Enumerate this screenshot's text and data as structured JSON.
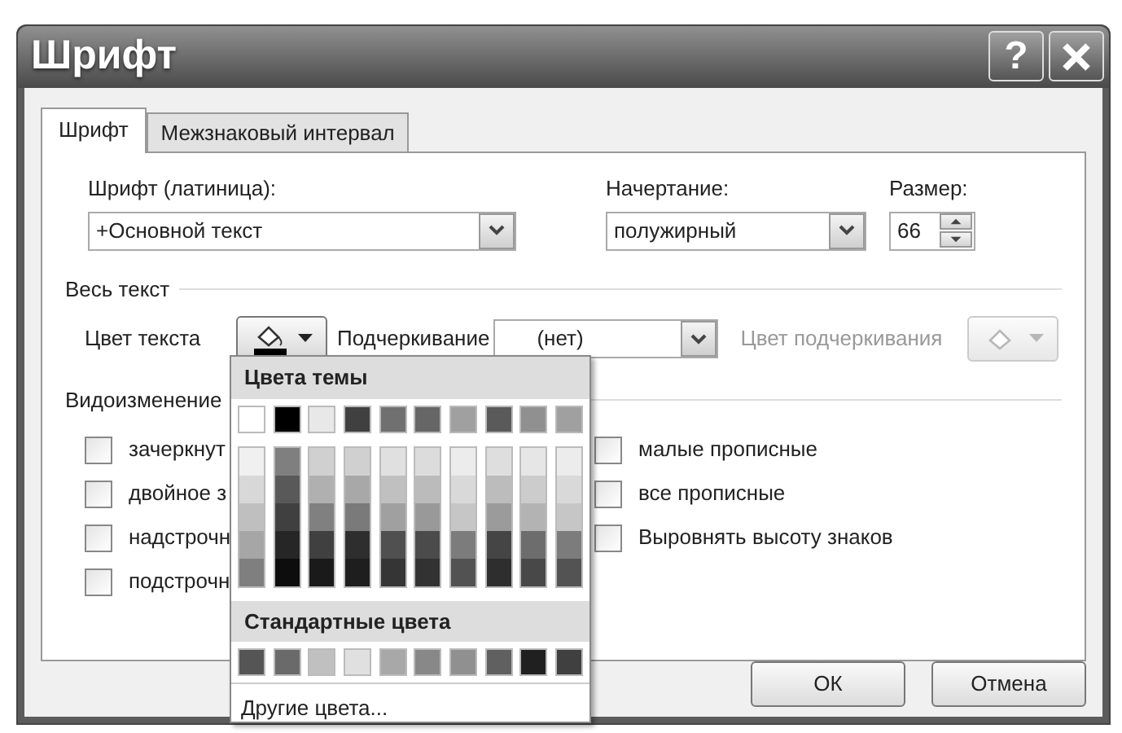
{
  "window": {
    "title": "Шрифт",
    "help": "?"
  },
  "tabs": [
    {
      "label": "Шрифт",
      "selected": true
    },
    {
      "label": "Межзнаковый интервал",
      "selected": false
    }
  ],
  "font_fields": [
    {
      "label": "Шрифт (латиница):",
      "value": "+Основной текст",
      "kind": "select"
    },
    {
      "label": "Начертание:",
      "value": "полужирный",
      "kind": "select"
    },
    {
      "label": "Размер:",
      "value": "66",
      "kind": "spinner"
    }
  ],
  "all_text": {
    "title": "Весь текст",
    "text_color_label": "Цвет текста",
    "underline_label": "Подчеркивание",
    "underline_value": "(нет)",
    "underline_color_label": "Цвет подчеркивания",
    "underline_color_disabled": true
  },
  "effects": {
    "title": "Видоизменение",
    "left": [
      {
        "label": "зачеркнут",
        "checked": false
      },
      {
        "label": "двойное з",
        "checked": false
      },
      {
        "label": "надстрочн",
        "checked": false
      },
      {
        "label": "подстрочн",
        "checked": false
      }
    ],
    "right": [
      {
        "label": "малые прописные",
        "checked": false
      },
      {
        "label": "все прописные",
        "checked": false
      },
      {
        "label": "Выровнять высоту знаков",
        "checked": false
      }
    ]
  },
  "color_menu": {
    "theme_title": "Цвета темы",
    "theme_colors": [
      {
        "color": "#ffffff"
      },
      {
        "color": "#000000"
      },
      {
        "color": "#e8e8e8"
      },
      {
        "color": "#404040"
      },
      {
        "color": "#707070"
      },
      {
        "color": "#666666"
      },
      {
        "color": "#a0a0a0"
      },
      {
        "color": "#5a5a5a"
      },
      {
        "color": "#909090"
      },
      {
        "color": "#a0a0a0"
      }
    ],
    "theme_shades": [
      {
        "shades": [
          {
            "color": "#f0f0f0"
          },
          {
            "color": "#d8d8d8"
          },
          {
            "color": "#bfbfbf"
          },
          {
            "color": "#a6a6a6"
          },
          {
            "color": "#7f7f7f"
          }
        ]
      },
      {
        "shades": [
          {
            "color": "#7f7f7f"
          },
          {
            "color": "#595959"
          },
          {
            "color": "#404040"
          },
          {
            "color": "#262626"
          },
          {
            "color": "#0d0d0d"
          }
        ]
      },
      {
        "shades": [
          {
            "color": "#d0d0d0"
          },
          {
            "color": "#b0b0b0"
          },
          {
            "color": "#808080"
          },
          {
            "color": "#404040"
          },
          {
            "color": "#1a1a1a"
          }
        ]
      },
      {
        "shades": [
          {
            "color": "#d0d0d0"
          },
          {
            "color": "#a8a8a8"
          },
          {
            "color": "#7a7a7a"
          },
          {
            "color": "#2e2e2e"
          },
          {
            "color": "#1e1e1e"
          }
        ]
      },
      {
        "shades": [
          {
            "color": "#e0e0e0"
          },
          {
            "color": "#c0c0c0"
          },
          {
            "color": "#a0a0a0"
          },
          {
            "color": "#505050"
          },
          {
            "color": "#353535"
          }
        ]
      },
      {
        "shades": [
          {
            "color": "#dcdcdc"
          },
          {
            "color": "#bbbbbb"
          },
          {
            "color": "#999999"
          },
          {
            "color": "#4b4b4b"
          },
          {
            "color": "#323232"
          }
        ]
      },
      {
        "shades": [
          {
            "color": "#ececec"
          },
          {
            "color": "#d9d9d9"
          },
          {
            "color": "#c6c6c6"
          },
          {
            "color": "#7c7c7c"
          },
          {
            "color": "#525252"
          }
        ]
      },
      {
        "shades": [
          {
            "color": "#dedede"
          },
          {
            "color": "#bcbcbc"
          },
          {
            "color": "#9b9b9b"
          },
          {
            "color": "#454545"
          },
          {
            "color": "#2e2e2e"
          }
        ]
      },
      {
        "shades": [
          {
            "color": "#e6e6e6"
          },
          {
            "color": "#cccccc"
          },
          {
            "color": "#b3b3b3"
          },
          {
            "color": "#6d6d6d"
          },
          {
            "color": "#484848"
          }
        ]
      },
      {
        "shades": [
          {
            "color": "#ececec"
          },
          {
            "color": "#d9d9d9"
          },
          {
            "color": "#c6c6c6"
          },
          {
            "color": "#7c7c7c"
          },
          {
            "color": "#535353"
          }
        ]
      }
    ],
    "standard_title": "Стандартные цвета",
    "standard_colors": [
      {
        "color": "#555555"
      },
      {
        "color": "#6a6a6a"
      },
      {
        "color": "#c0c0c0"
      },
      {
        "color": "#e0e0e0"
      },
      {
        "color": "#a8a8a8"
      },
      {
        "color": "#888888"
      },
      {
        "color": "#909090"
      },
      {
        "color": "#606060"
      },
      {
        "color": "#202020"
      },
      {
        "color": "#404040"
      }
    ],
    "more": "Другие цвета..."
  },
  "buttons": [
    {
      "label": "ОК"
    },
    {
      "label": "Отмена"
    }
  ]
}
